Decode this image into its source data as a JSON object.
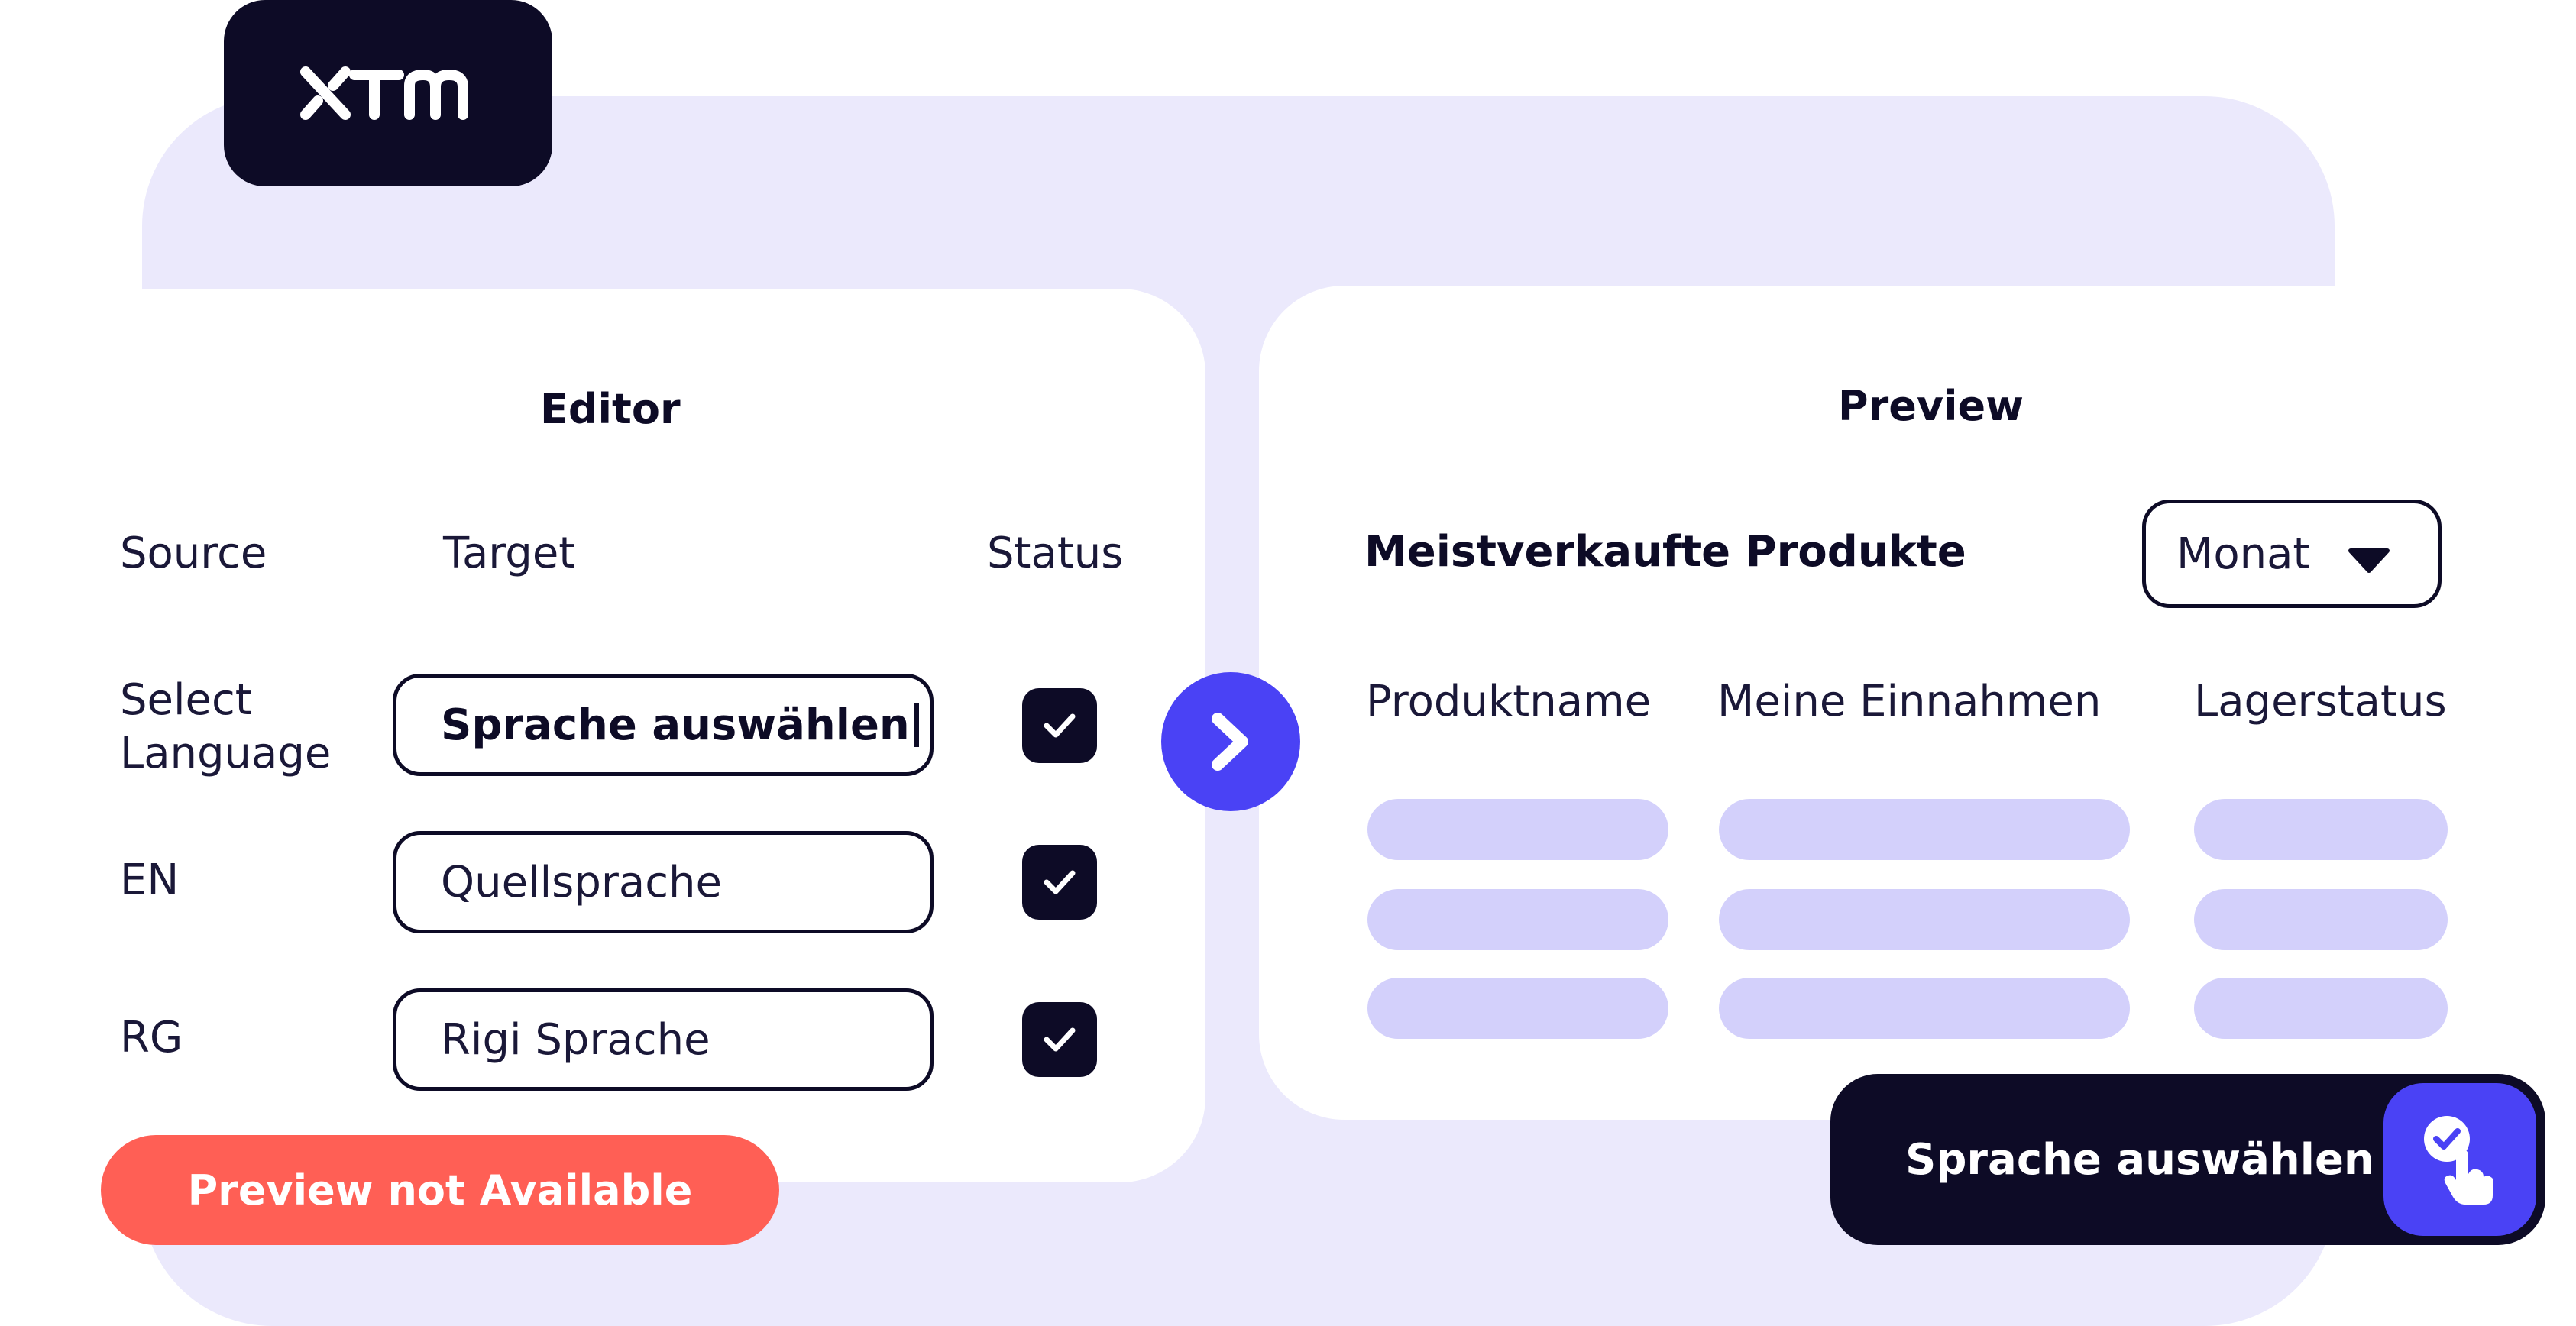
{
  "brand": {
    "logo_text": "XTM",
    "colors": {
      "dark": "#0d0b26",
      "accent": "#4a42f5",
      "warning": "#ff5f55",
      "skeleton": "#d3d0fb",
      "backdrop": "#ebe9fc"
    }
  },
  "editor": {
    "title": "Editor",
    "columns": {
      "source": "Source",
      "target": "Target",
      "status": "Status"
    },
    "rows": [
      {
        "source": "Select Language",
        "target": "Sprache auswählen",
        "status_icon": "check-icon"
      },
      {
        "source": "EN",
        "target": "Quellsprache",
        "status_icon": "check-icon"
      },
      {
        "source": "RG",
        "target": "Rigi Sprache",
        "status_icon": "check-icon"
      }
    ],
    "preview_status_button": "Preview not Available"
  },
  "navigation": {
    "next_icon": "chevron-right-icon"
  },
  "preview": {
    "title": "Preview",
    "section_heading": "Meistverkaufte Produkte",
    "period_select": {
      "value": "Monat",
      "icon": "caret-down-icon"
    },
    "columns": [
      "Produktname",
      "Meine Einnahmen",
      "Lagerstatus"
    ]
  },
  "cta": {
    "label": "Sprache auswählen",
    "icon": "tap-check-icon"
  }
}
